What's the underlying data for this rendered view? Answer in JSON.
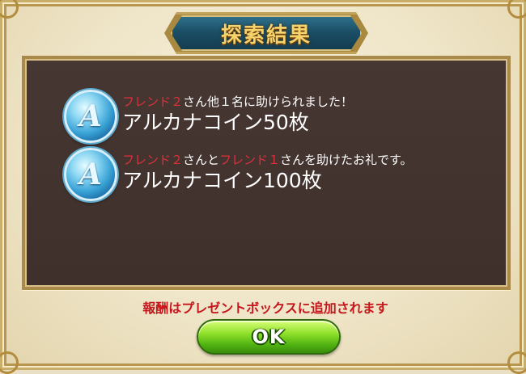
{
  "title": "探索結果",
  "rewards": [
    {
      "icon": "arcana-coin-icon",
      "friend_a": "フレンド２",
      "caption_rest": "さん他１名に助けられました！",
      "amount": "アルカナコイン50枚"
    },
    {
      "icon": "arcana-coin-icon",
      "friend_a": "フレンド２",
      "mid": "さんと",
      "friend_b": "フレンド１",
      "caption_rest": "さんを助けたお礼です。",
      "amount": "アルカナコイン100枚"
    }
  ],
  "notice": "報酬はプレゼントボックスに追加されます",
  "ok_label": "OK",
  "coin_glyph": "A",
  "colors": {
    "friend_name": "#e0303a",
    "notice": "#c4161c",
    "panel": "#3f302c",
    "title_text": "#f6d26a",
    "ok_button": "#6ccf1c"
  }
}
